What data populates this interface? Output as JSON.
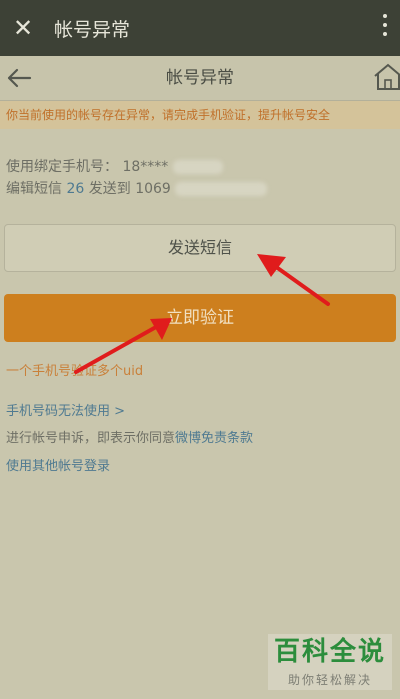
{
  "app_bar": {
    "close_glyph": "✕",
    "title": "帐号异常"
  },
  "nav_bar": {
    "title": "帐号异常"
  },
  "warning": {
    "text": "你当前使用的帐号存在异常，请完成手机验证，提升帐号安全"
  },
  "info": {
    "phone_label": "使用绑定手机号：",
    "phone_visible": "18****",
    "sms_prefix": "编辑短信",
    "sms_code": "26",
    "sms_middle": "发送到",
    "sms_target_visible": "1069"
  },
  "buttons": {
    "send_sms": "发送短信",
    "verify_now": "立即验证"
  },
  "links": {
    "multi_uid": "一个手机号验证多个uid",
    "phone_unusable": "手机号码无法使用 >",
    "appeal_prefix": "进行帐号申诉，即表示你同意",
    "appeal_terms": "微博免责条款",
    "other_account": "使用其他帐号登录"
  },
  "watermark": {
    "title": "百科全说",
    "subtitle": "助你轻松解决"
  },
  "colors": {
    "app_bar_bg": "#3d4136",
    "page_bg": "#c9c6ad",
    "warning_text": "#c0702a",
    "verify_button": "#cd7f1e",
    "link_blue": "#4f7a91",
    "annotation_arrow": "#e01c1c",
    "watermark_green": "#2c8d3c"
  },
  "icons": {
    "close": "close-icon",
    "more": "more-vertical-icon",
    "back": "back-arrow-icon",
    "home": "home-icon"
  }
}
